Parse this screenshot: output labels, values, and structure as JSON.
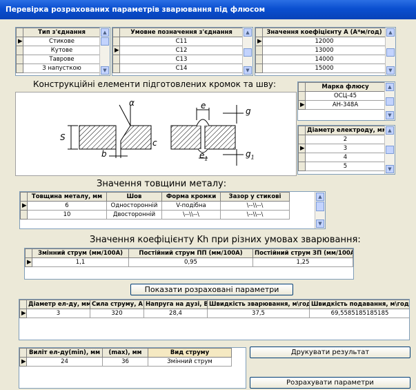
{
  "window": {
    "title": "Перевірка розрахованих параметрів зварювання під флюсом"
  },
  "joint_type": {
    "header": "Тип з'єднання",
    "rows": [
      "Стикове",
      "Кутове",
      "Таврове",
      "З напусткою"
    ],
    "selected": 0
  },
  "joint_designation": {
    "header": "Умовне позначення з'єднання",
    "rows": [
      "С11",
      "С12",
      "С13",
      "С14"
    ],
    "selected": 1
  },
  "coefficient_a": {
    "header": "Значення коефіцієнту  А  (А*м/год)",
    "rows": [
      "12000",
      "13000",
      "14000",
      "15000"
    ],
    "selected": 0
  },
  "section_edges": {
    "label": "Конструкційні елементи підготовлених кромок та шву:"
  },
  "flux": {
    "header": "Марка флюсу",
    "rows": [
      "ОСЦ-45",
      "АН-348А"
    ],
    "selected": 1
  },
  "electrode": {
    "header": "Діаметр електроду, мм",
    "rows": [
      "2",
      "3",
      "4",
      "5"
    ],
    "selected": 1
  },
  "drawing_labels": {
    "s": "S",
    "b": "b",
    "alpha": "α",
    "c": "c",
    "e": "e",
    "g": "g",
    "e1": "e",
    "e1_sub": "1",
    "g1": "g",
    "g1_sub": "1"
  },
  "thickness": {
    "label": "Значення товщини металу:",
    "headers": [
      "Товщина металу, мм",
      "Шов",
      "Форма кромки",
      "Зазор у стикові"
    ],
    "rows": [
      [
        "6",
        "Односторонній",
        "V-подібна",
        "\\--\\\\--\\"
      ],
      [
        "10",
        "Двосторонній",
        "\\--\\\\--\\",
        "\\--\\\\--\\"
      ]
    ],
    "selected": 0
  },
  "kh": {
    "label": "Значення коефіцієнту Kh при різних умовах зварювання:",
    "headers": [
      "Змінний струм  (мм/100А)",
      "Постійний струм ПП (мм/100А)",
      "Постійний струм ЗП (мм/100А)"
    ],
    "rows": [
      [
        "1,1",
        "0,95",
        "1,25"
      ]
    ]
  },
  "show_button": {
    "label": "Показати розраховані параметри"
  },
  "results": {
    "headers": [
      "Діаметр ел-ду, мм",
      "Сила струму, А",
      "Напруга на дузі, В",
      "Швидкість зварювання, м\\год",
      "Швидкість подавання, м\\год"
    ],
    "rows": [
      [
        "3",
        "320",
        "28,4",
        "37,5",
        "69,5585185185185"
      ]
    ]
  },
  "extension": {
    "headers": [
      "Виліт ел-ду(min), мм",
      "(max), мм",
      "Вид струму"
    ],
    "rows": [
      [
        "24",
        "36",
        "Змінний струм"
      ]
    ]
  },
  "print_button": {
    "label": "Друкувати результат"
  },
  "calc_button": {
    "label": "Розрахувати параметри"
  }
}
